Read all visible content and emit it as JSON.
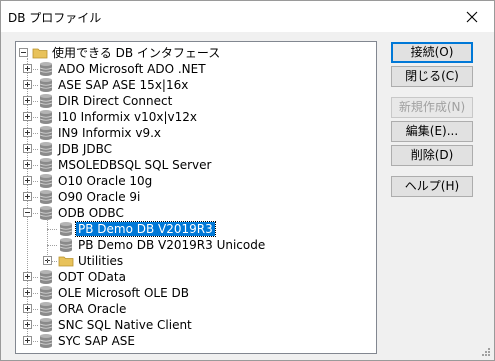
{
  "window": {
    "title": "DB プロファイル"
  },
  "tree": {
    "root_label": "使用できる DB インタフェース",
    "items": [
      {
        "label": "ADO Microsoft ADO .NET",
        "expanded": false
      },
      {
        "label": "ASE SAP ASE 15x|16x",
        "expanded": false
      },
      {
        "label": "DIR Direct Connect",
        "expanded": false
      },
      {
        "label": "I10 Informix v10x|v12x",
        "expanded": false
      },
      {
        "label": "IN9 Informix v9.x",
        "expanded": false
      },
      {
        "label": "JDB JDBC",
        "expanded": false
      },
      {
        "label": "MSOLEDBSQL SQL Server",
        "expanded": false
      },
      {
        "label": "O10 Oracle 10g",
        "expanded": false
      },
      {
        "label": "O90 Oracle 9i",
        "expanded": false
      },
      {
        "label": "ODB ODBC",
        "expanded": true
      },
      {
        "label": "ODT OData",
        "expanded": false
      },
      {
        "label": "OLE Microsoft OLE DB",
        "expanded": false
      },
      {
        "label": "ORA Oracle",
        "expanded": false
      },
      {
        "label": "SNC SQL Native Client",
        "expanded": false
      },
      {
        "label": "SYC SAP ASE",
        "expanded": false
      }
    ],
    "odbc_children": [
      {
        "label": "PB Demo DB V2019R3",
        "selected": true,
        "icon": "database-icon"
      },
      {
        "label": "PB Demo DB V2019R3 Unicode",
        "selected": false,
        "icon": "database-icon"
      },
      {
        "label": "Utilities",
        "selected": false,
        "icon": "folder-icon"
      }
    ]
  },
  "buttons": {
    "connect": "接続(O)",
    "close": "閉じる(C)",
    "new": "新規作成(N)",
    "edit": "編集(E)...",
    "delete": "削除(D)",
    "help": "ヘルプ(H)"
  },
  "colors": {
    "selection": "#0078d7",
    "db_icon": "#8a8a8a",
    "folder": "#e8c25a"
  }
}
